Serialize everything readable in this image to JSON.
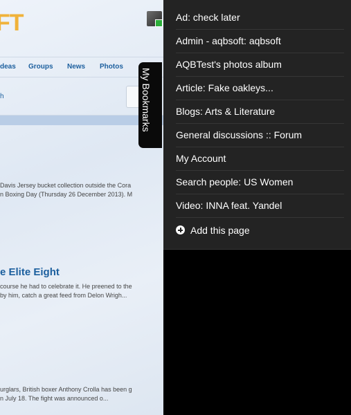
{
  "site": {
    "logo_text": "FT",
    "nav": [
      "deas",
      "Groups",
      "News",
      "Photos"
    ],
    "sub_link": "h",
    "snippet1": [
      "Davis Jersey bucket collection outside the Cora",
      "n Boxing Day (Thursday 26 December 2013). M"
    ],
    "headline2": "e Elite Eight",
    "snippet2": [
      "course he had to celebrate it. He preened to the",
      "by him, catch a great feed from Delon Wrigh..."
    ],
    "snippet3": [
      "urglars, British boxer Anthony Crolla has been g",
      "n July 18. The fight was announced o..."
    ]
  },
  "bookmarks_tab_label": "My Bookmarks",
  "bookmarks": [
    "Ad: check later",
    "Admin - aqbsoft: aqbsoft",
    "AQBTest's photos album",
    "Article: Fake oakleys...",
    "Blogs: Arts & Literature",
    "General discussions :: Forum",
    "My Account",
    "Search people: US Women",
    "Video: INNA feat. Yandel"
  ],
  "add_page_label": "Add this page",
  "colors": {
    "panel_bg": "#232323",
    "link": "#1c5f9e",
    "logo": "#f0b23a"
  }
}
